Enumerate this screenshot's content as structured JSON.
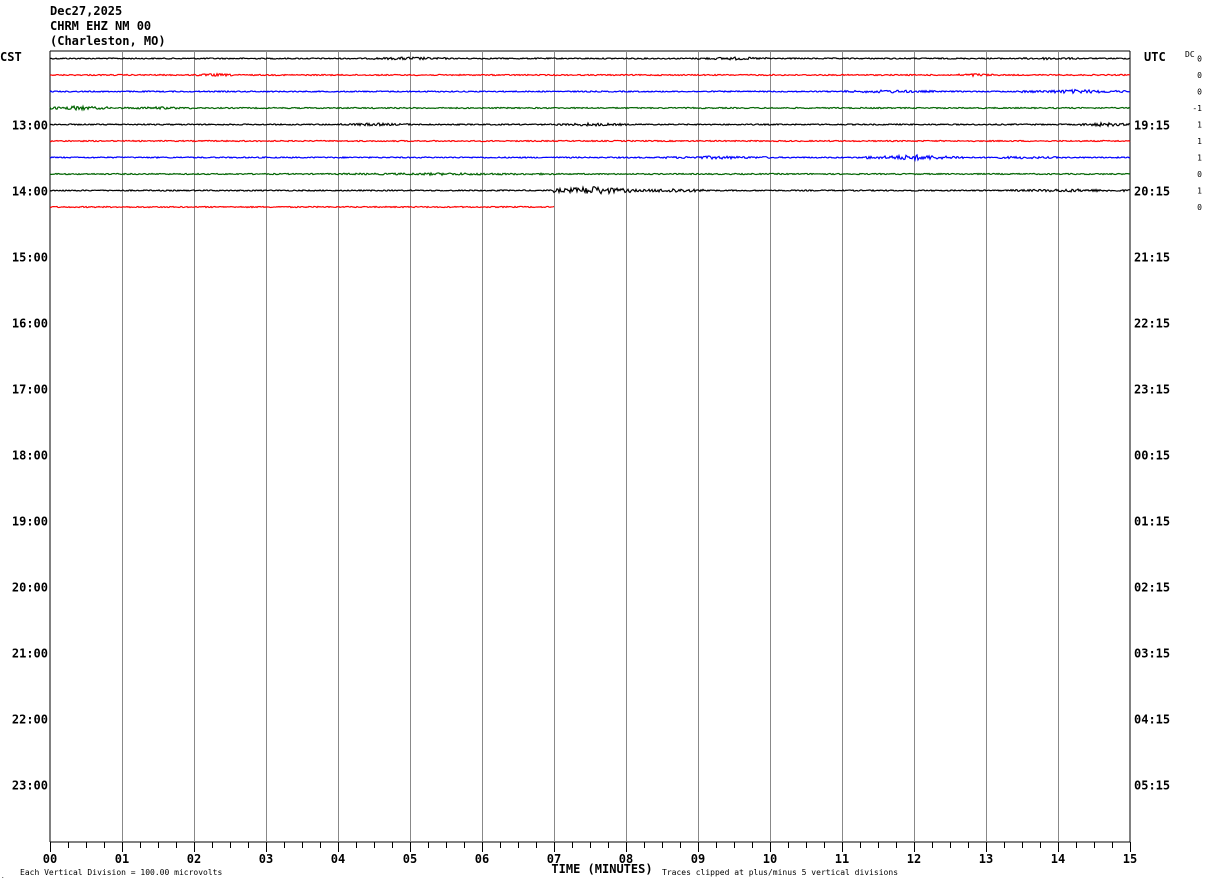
{
  "header": {
    "date": "Dec27,2025",
    "station": "CHRM EHZ NM 00",
    "location": "(Charleston, MO)"
  },
  "chart_data": {
    "type": "line",
    "subtype": "helicorder",
    "left_timezone_label": "CST",
    "right_timezone_label": "UTC",
    "dc_label": "DC",
    "xlabel": "TIME (MINUTES)",
    "x_ticks": [
      "00",
      "01",
      "02",
      "03",
      "04",
      "05",
      "06",
      "07",
      "08",
      "09",
      "10",
      "11",
      "12",
      "13",
      "14",
      "15"
    ],
    "xlim": [
      0,
      15
    ],
    "minor_tick_interval_minutes": 0.25,
    "left_hour_labels": [
      "13:00",
      "14:00",
      "15:00",
      "16:00",
      "17:00",
      "18:00",
      "19:00",
      "20:00",
      "21:00",
      "22:00",
      "23:00"
    ],
    "right_hour_labels": [
      "19:15",
      "20:15",
      "21:15",
      "22:15",
      "23:15",
      "00:15",
      "01:15",
      "02:15",
      "03:15",
      "04:15",
      "05:15"
    ],
    "first_hour_label_row": 4,
    "rows_per_hour": 4,
    "total_rows": 48,
    "trace_colors": [
      "#000000",
      "#ff0000",
      "#0000ff",
      "#006400"
    ],
    "grid_color": "#888888",
    "traces": [
      {
        "row": 0,
        "end_minute": 15,
        "dc": "0",
        "noise": [
          [
            4.5,
            5.5,
            1.6
          ],
          [
            9,
            10,
            1.5
          ],
          [
            13.5,
            14.3,
            1.3
          ]
        ]
      },
      {
        "row": 1,
        "end_minute": 15,
        "dc": "0",
        "noise": [
          [
            2,
            2.6,
            1.5
          ],
          [
            12.6,
            13.1,
            1.6
          ]
        ]
      },
      {
        "row": 2,
        "end_minute": 15,
        "dc": "0",
        "noise": [
          [
            11,
            12.3,
            1.6
          ],
          [
            13.5,
            15,
            2.0
          ]
        ]
      },
      {
        "row": 3,
        "end_minute": 15,
        "dc": "-1",
        "noise": [
          [
            0,
            0.8,
            2.3
          ],
          [
            1,
            2,
            1.3
          ]
        ]
      },
      {
        "row": 4,
        "end_minute": 15,
        "dc": "1",
        "noise": [
          [
            4,
            5,
            1.5
          ],
          [
            7,
            8,
            1.6
          ],
          [
            14.3,
            15,
            2.0
          ]
        ]
      },
      {
        "row": 5,
        "end_minute": 15,
        "dc": "1",
        "noise": []
      },
      {
        "row": 6,
        "end_minute": 15,
        "dc": "1",
        "noise": [
          [
            8.5,
            10,
            1.6
          ],
          [
            11.3,
            12.7,
            2.8
          ],
          [
            13,
            14,
            1.3
          ]
        ]
      },
      {
        "row": 7,
        "end_minute": 15,
        "dc": "0",
        "noise": [
          [
            4,
            7,
            1.2
          ]
        ]
      },
      {
        "row": 8,
        "end_minute": 15,
        "dc": "1",
        "noise": [
          [
            7,
            8.1,
            4.5
          ],
          [
            8.1,
            9.2,
            2.2
          ],
          [
            13.3,
            15,
            1.6
          ]
        ]
      },
      {
        "row": 9,
        "end_minute": 7,
        "dc": "0",
        "noise": []
      }
    ],
    "footer_left": "Each Vertical Division =  100.00 microvolts",
    "footer_right": "Traces clipped at plus/minus 5 vertical divisions"
  }
}
